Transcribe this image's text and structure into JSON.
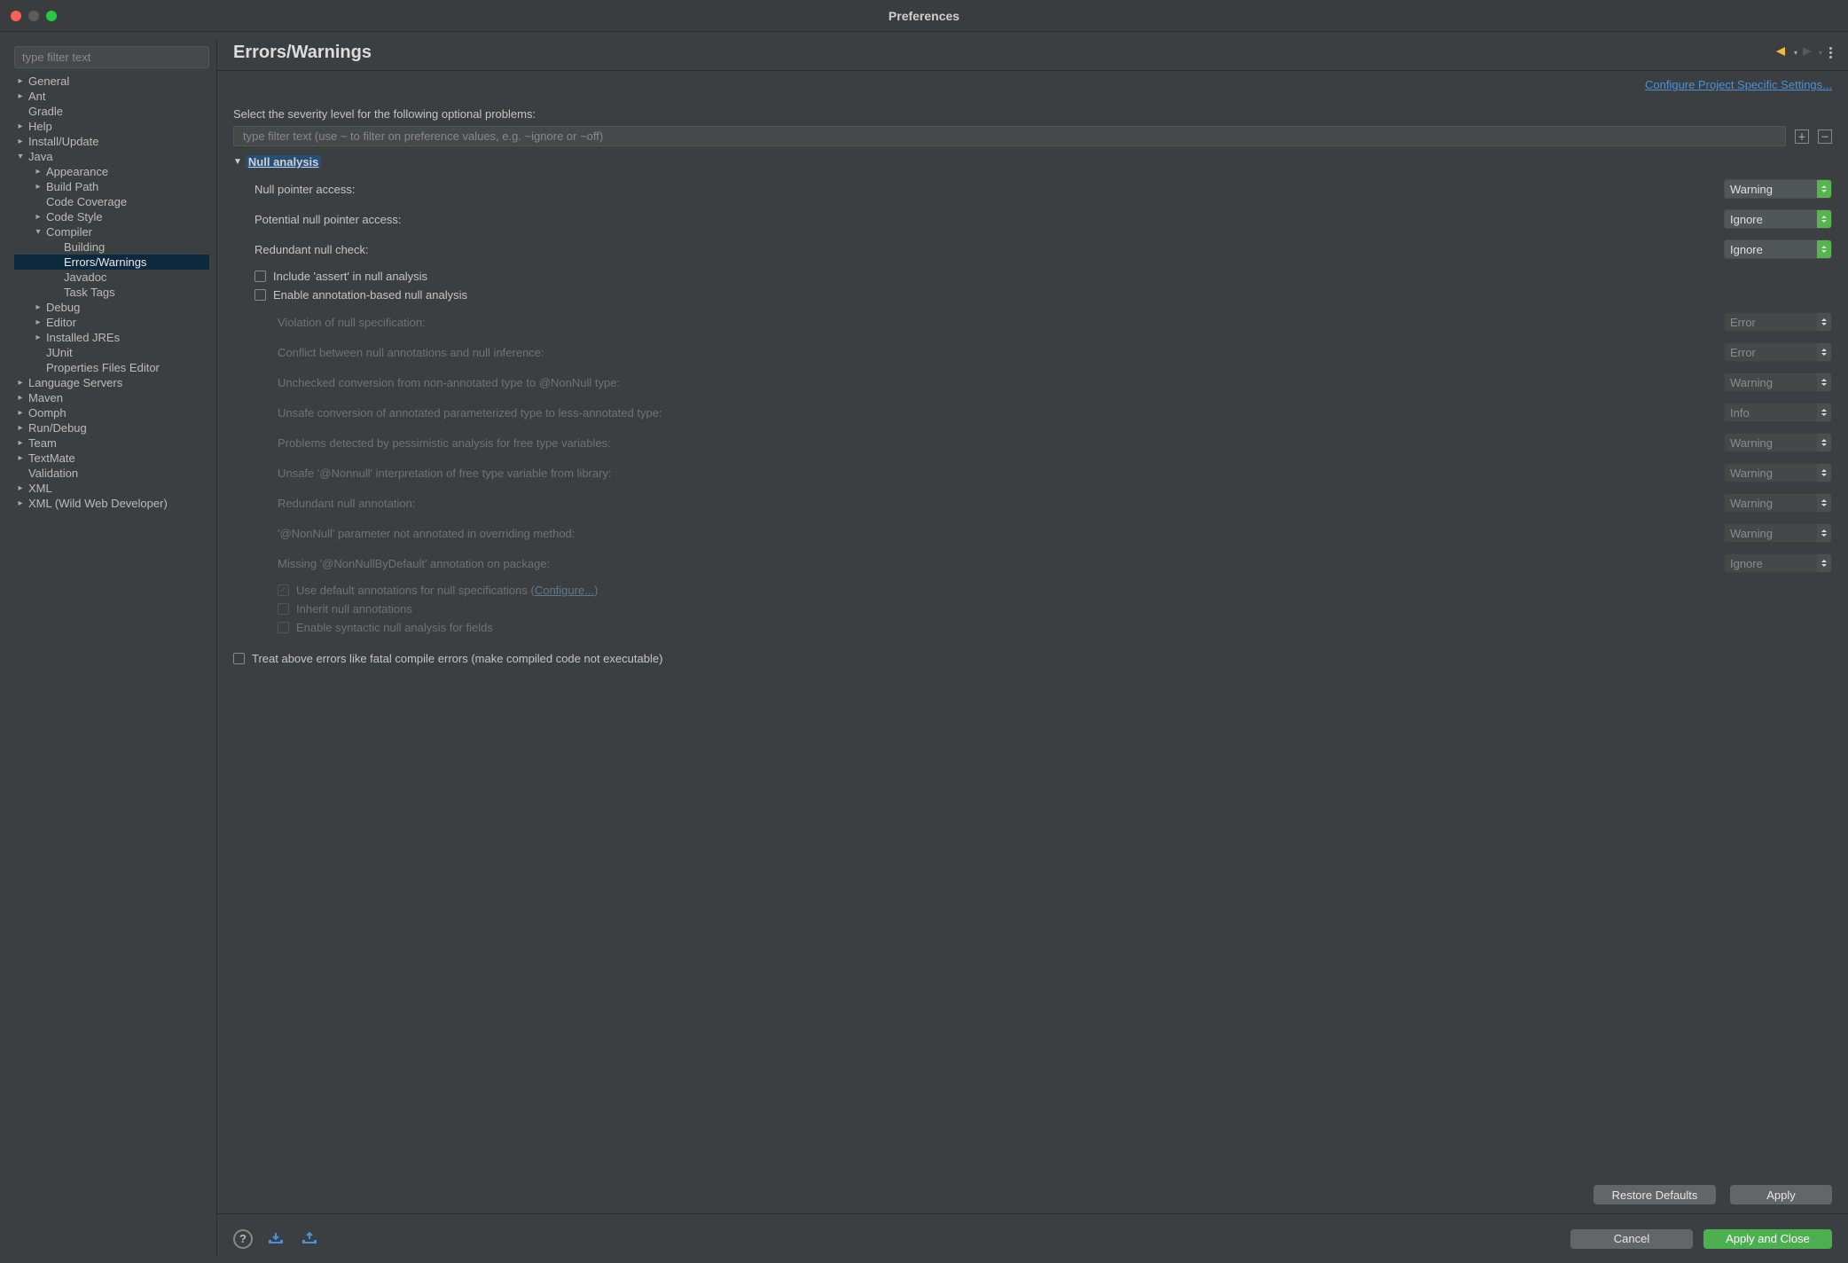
{
  "window": {
    "title": "Preferences"
  },
  "sidebar": {
    "filter_placeholder": "type filter text",
    "items": [
      {
        "label": "General",
        "indent": 1,
        "arrow": "right"
      },
      {
        "label": "Ant",
        "indent": 1,
        "arrow": "right"
      },
      {
        "label": "Gradle",
        "indent": 1,
        "arrow": "none"
      },
      {
        "label": "Help",
        "indent": 1,
        "arrow": "right"
      },
      {
        "label": "Install/Update",
        "indent": 1,
        "arrow": "right"
      },
      {
        "label": "Java",
        "indent": 1,
        "arrow": "down"
      },
      {
        "label": "Appearance",
        "indent": 2,
        "arrow": "right"
      },
      {
        "label": "Build Path",
        "indent": 2,
        "arrow": "right"
      },
      {
        "label": "Code Coverage",
        "indent": 2,
        "arrow": "none"
      },
      {
        "label": "Code Style",
        "indent": 2,
        "arrow": "right"
      },
      {
        "label": "Compiler",
        "indent": 2,
        "arrow": "down"
      },
      {
        "label": "Building",
        "indent": 3,
        "arrow": "none"
      },
      {
        "label": "Errors/Warnings",
        "indent": 3,
        "arrow": "none",
        "selected": true
      },
      {
        "label": "Javadoc",
        "indent": 3,
        "arrow": "none"
      },
      {
        "label": "Task Tags",
        "indent": 3,
        "arrow": "none"
      },
      {
        "label": "Debug",
        "indent": 2,
        "arrow": "right"
      },
      {
        "label": "Editor",
        "indent": 2,
        "arrow": "right"
      },
      {
        "label": "Installed JREs",
        "indent": 2,
        "arrow": "right"
      },
      {
        "label": "JUnit",
        "indent": 2,
        "arrow": "none"
      },
      {
        "label": "Properties Files Editor",
        "indent": 2,
        "arrow": "none"
      },
      {
        "label": "Language Servers",
        "indent": 1,
        "arrow": "right"
      },
      {
        "label": "Maven",
        "indent": 1,
        "arrow": "right"
      },
      {
        "label": "Oomph",
        "indent": 1,
        "arrow": "right"
      },
      {
        "label": "Run/Debug",
        "indent": 1,
        "arrow": "right"
      },
      {
        "label": "Team",
        "indent": 1,
        "arrow": "right"
      },
      {
        "label": "TextMate",
        "indent": 1,
        "arrow": "right"
      },
      {
        "label": "Validation",
        "indent": 1,
        "arrow": "none"
      },
      {
        "label": "XML",
        "indent": 1,
        "arrow": "right"
      },
      {
        "label": "XML (Wild Web Developer)",
        "indent": 1,
        "arrow": "right"
      }
    ]
  },
  "page": {
    "title": "Errors/Warnings",
    "config_link": "Configure Project Specific Settings...",
    "intro": "Select the severity level for the following optional problems:",
    "filter_placeholder": "type filter text (use ~ to filter on preference values, e.g. ~ignore or ~off)",
    "section": "Null analysis",
    "rows": [
      {
        "label": "Null pointer access:",
        "value": "Warning",
        "enabled": true
      },
      {
        "label": "Potential null pointer access:",
        "value": "Ignore",
        "enabled": true
      },
      {
        "label": "Redundant null check:",
        "value": "Ignore",
        "enabled": true
      }
    ],
    "check_include_assert": "Include 'assert' in null analysis",
    "check_annotation": "Enable annotation-based null analysis",
    "annotation_rows": [
      {
        "label": "Violation of null specification:",
        "value": "Error",
        "enabled": false
      },
      {
        "label": "Conflict between null annotations and null inference:",
        "value": "Error",
        "enabled": false
      },
      {
        "label": "Unchecked conversion from non-annotated type to @NonNull type:",
        "value": "Warning",
        "enabled": false
      },
      {
        "label": "Unsafe conversion of annotated parameterized type to less-annotated type:",
        "value": "Info",
        "enabled": false
      },
      {
        "label": "Problems detected by pessimistic analysis for free type variables:",
        "value": "Warning",
        "enabled": false
      },
      {
        "label": "Unsafe '@Nonnull' interpretation of free type variable from library:",
        "value": "Warning",
        "enabled": false
      },
      {
        "label": "Redundant null annotation:",
        "value": "Warning",
        "enabled": false
      },
      {
        "label": "'@NonNull' parameter not annotated in overriding method:",
        "value": "Warning",
        "enabled": false
      },
      {
        "label": "Missing '@NonNullByDefault' annotation on package:",
        "value": "Ignore",
        "enabled": false
      }
    ],
    "default_ann_prefix": "Use default annotations for null specifications (",
    "default_ann_link": "Configure...",
    "default_ann_suffix": ")",
    "inherit_ann": "Inherit null annotations",
    "syntactic_ann": "Enable syntactic null analysis for fields",
    "treat_fatal": "Treat above errors like fatal compile errors (make compiled code not executable)"
  },
  "buttons": {
    "restore": "Restore Defaults",
    "apply": "Apply",
    "cancel": "Cancel",
    "apply_close": "Apply and Close"
  }
}
